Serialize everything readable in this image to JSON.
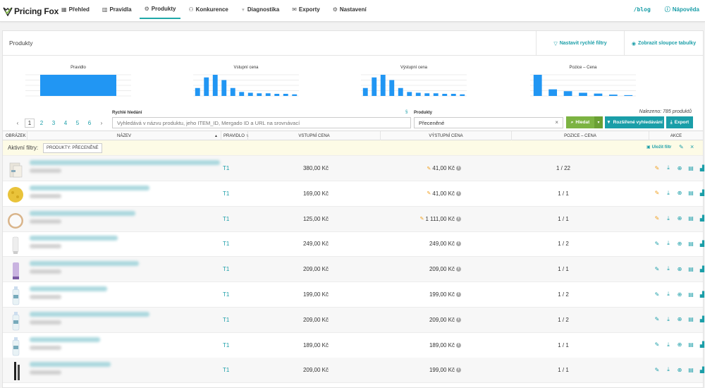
{
  "brand": {
    "name": "Pricing Fox"
  },
  "nav": {
    "items": [
      {
        "label": "Přehled",
        "icon": "dashboard-icon",
        "glyph": "▦"
      },
      {
        "label": "Pravidla",
        "icon": "rules-icon",
        "glyph": "▥"
      },
      {
        "label": "Produkty",
        "icon": "products-icon",
        "glyph": "⚙"
      },
      {
        "label": "Konkurence",
        "icon": "competitors-icon",
        "glyph": "⚇"
      },
      {
        "label": "Diagnostika",
        "icon": "diagnostics-icon",
        "glyph": "♆"
      },
      {
        "label": "Exporty",
        "icon": "exports-icon",
        "glyph": "✉"
      },
      {
        "label": "Nastavení",
        "icon": "settings-icon",
        "glyph": "⚙"
      }
    ],
    "active_index": 2,
    "blog": "/blog",
    "help": "Nápověda"
  },
  "panel": {
    "title": "Produkty",
    "quick_filters_btn": "Nastavit rychlé filtry",
    "columns_btn": "Zobrazit sloupce tabulky"
  },
  "chart_data": [
    {
      "type": "bar",
      "title": "Pravidlo",
      "values": [
        1
      ]
    },
    {
      "type": "bar",
      "title": "Vstupní cena",
      "values": [
        3,
        7,
        8,
        6,
        3,
        1.5,
        1.2,
        1,
        1,
        0.8,
        0.8,
        0.6
      ]
    },
    {
      "type": "bar",
      "title": "Výstupní cena",
      "values": [
        3,
        7,
        8,
        6,
        3,
        1.5,
        1.2,
        1,
        1,
        0.8,
        0.8,
        0.6
      ]
    },
    {
      "type": "bar",
      "title": "Pozice – Cena",
      "values": [
        8,
        2.5,
        1.8,
        1.2,
        0.9,
        0.5,
        0.3
      ]
    }
  ],
  "pager": {
    "pages": [
      "1",
      "2",
      "3",
      "4",
      "5",
      "6"
    ],
    "prev": "‹",
    "next": "›",
    "active": 0
  },
  "search": {
    "label": "Rychlé hledání",
    "placeholder": "Vyhledává v názvu produktu, jeho ITEM_ID, Mergado ID a URL na srovnávací",
    "products_label": "Produkty",
    "products_value": "Přeceněné",
    "found": "Nalezeno: 785 produktů",
    "search_btn": "Hledat",
    "advanced_btn": "Rozšířené vyhledávání",
    "export_btn": "Export"
  },
  "table": {
    "headers": {
      "image": "OBRÁZEK",
      "name": "NÁZEV",
      "rule": "PRAVIDLO",
      "input_price": "VSTUPNÍ CENA",
      "output_price": "VÝSTUPNÍ CENA",
      "position": "POZICE – CENA",
      "actions": "AKCE"
    },
    "active_filters_label": "Aktivní filtry:",
    "active_filter_chip": "PRODUKTY: PŘECENĚNÉ",
    "save_filter": "Uložit filtr",
    "rows": [
      {
        "rule": "T1",
        "input": "380,00 Kč",
        "output": "41,00 Kč",
        "override": true,
        "position": "1 / 22",
        "thumb": "box"
      },
      {
        "rule": "T1",
        "input": "169,00 Kč",
        "output": "41,00 Kč",
        "override": true,
        "position": "1 / 1",
        "thumb": "sponge"
      },
      {
        "rule": "T1",
        "input": "125,00 Kč",
        "output": "1 111,00 Kč",
        "override": true,
        "position": "1 / 1",
        "thumb": "jar"
      },
      {
        "rule": "T1",
        "input": "249,00 Kč",
        "output": "249,00 Kč",
        "override": false,
        "position": "1 / 2",
        "thumb": "tube"
      },
      {
        "rule": "T1",
        "input": "209,00 Kč",
        "output": "209,00 Kč",
        "override": false,
        "position": "1 / 1",
        "thumb": "purple"
      },
      {
        "rule": "T1",
        "input": "199,00 Kč",
        "output": "199,00 Kč",
        "override": false,
        "position": "1 / 2",
        "thumb": "bottle"
      },
      {
        "rule": "T1",
        "input": "209,00 Kč",
        "output": "209,00 Kč",
        "override": false,
        "position": "1 / 2",
        "thumb": "bottle"
      },
      {
        "rule": "T1",
        "input": "189,00 Kč",
        "output": "189,00 Kč",
        "override": false,
        "position": "1 / 1",
        "thumb": "bottle"
      },
      {
        "rule": "T1",
        "input": "209,00 Kč",
        "output": "199,00 Kč",
        "override": false,
        "position": "1 / 1",
        "thumb": "mascara"
      }
    ],
    "row_actions": [
      "edit-icon",
      "download-icon",
      "zoom-icon",
      "layout-icon",
      "chart-icon"
    ]
  },
  "colors": {
    "accent": "#1a9ea8",
    "bar": "#2196f3",
    "green": "#7cb342",
    "orange": "#f0a020",
    "filterbar": "#fdfbe6"
  }
}
